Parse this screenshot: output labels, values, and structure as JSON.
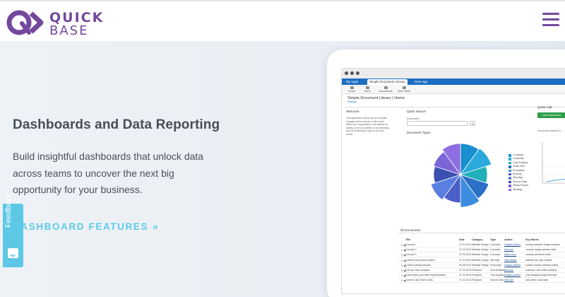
{
  "brand": {
    "word1": "QUICK",
    "word2": "BASE",
    "color": "#74489d"
  },
  "nav": {
    "menu_icon": "hamburger-menu-icon"
  },
  "hero": {
    "title": "Dashboards and Data Reporting",
    "body": "Build insightful dashboards that unlock data across teams to uncover the next big opportunity for your business.",
    "cta": "DASHBOARD FEATURES",
    "cta_chevron": "»",
    "cta_color": "#5cc8e6"
  },
  "feedback": {
    "label": "Feedback",
    "icon": "smile-icon"
  },
  "app": {
    "tabs": [
      "My Apps",
      "Simple Document Library",
      "New App"
    ],
    "toolbar": [
      "Home",
      "Users",
      "Documents",
      "New Table"
    ],
    "breadcrumb": "Simple Document Library",
    "breadcrumb_page": "Home",
    "breadcrumb_sub": "Settings",
    "welcome_heading": "Welcome",
    "welcome_text": "This application allows you to centrally manage all documents or files used within your organization. Get started by adding some documents or by extending and customizing the app to suit your needs.",
    "quick_search": "Quick Search",
    "documents_label": "Documents",
    "search_button": "Q",
    "quick_add": "Quick Add",
    "new_document": "New Document",
    "documents_added": "Documents Added Ov",
    "document_types": "Document Types",
    "all_documents": "All Documents",
    "legend": [
      {
        "label": "Concepts",
        "color": "#1a8fcf"
      },
      {
        "label": "Corporate",
        "color": "#2aa9dc"
      },
      {
        "label": "Cost Analysis",
        "color": "#20b0b8"
      },
      {
        "label": "Email Plan",
        "color": "#2b6fc6"
      },
      {
        "label": "Production",
        "color": "#3c8de0"
      },
      {
        "label": "Security",
        "color": "#4b5fc9"
      },
      {
        "label": "Site Map",
        "color": "#5a7fe0"
      },
      {
        "label": "Source Data",
        "color": "#3a4fb0"
      },
      {
        "label": "Status Report",
        "color": "#7b64d8"
      },
      {
        "label": "Strategy",
        "color": "#8e6ee0"
      }
    ],
    "table_headers": [
      "Title",
      "Date",
      "Category",
      "Type",
      "Author",
      "Key Words"
    ],
    "table_rows": [
      [
        "Concept 1",
        "07-20-2012",
        "Website Design",
        "Concepts",
        "Gregory Baxter",
        "concept website design example"
      ],
      [
        "Concept 2",
        "07-20-2012",
        "Website Design",
        "Concepts",
        "test user",
        "concept design website draft"
      ],
      [
        "Concept 3",
        "07-20-2012",
        "Website Design",
        "Concepts",
        "Alfred Cruz",
        "concept wireframe draft"
      ],
      [
        "Content and product outline",
        "07-20-2012",
        "Website Design",
        "Site Map",
        "Chris Baker",
        "website site map content"
      ],
      [
        "Content writing samples",
        "06-05-2012",
        "Website Design",
        "Production",
        "Gregory Baxter",
        "content sample website writing"
      ],
      [
        "Cost per User Analysis",
        "07-21-2012",
        "Financial",
        "Cost Analysis",
        "test user",
        "customer cost online analysis"
      ],
      [
        "Costs before and after implementation",
        "07-21-2012",
        "Financial",
        "Cost Analysis",
        "Gregory Baxter",
        "cost analysis budget financial"
      ],
      [
        "Current Call Center Costs",
        "07-21-2012",
        "Financial",
        "Source Data",
        "test user",
        "call center costs data"
      ]
    ]
  }
}
